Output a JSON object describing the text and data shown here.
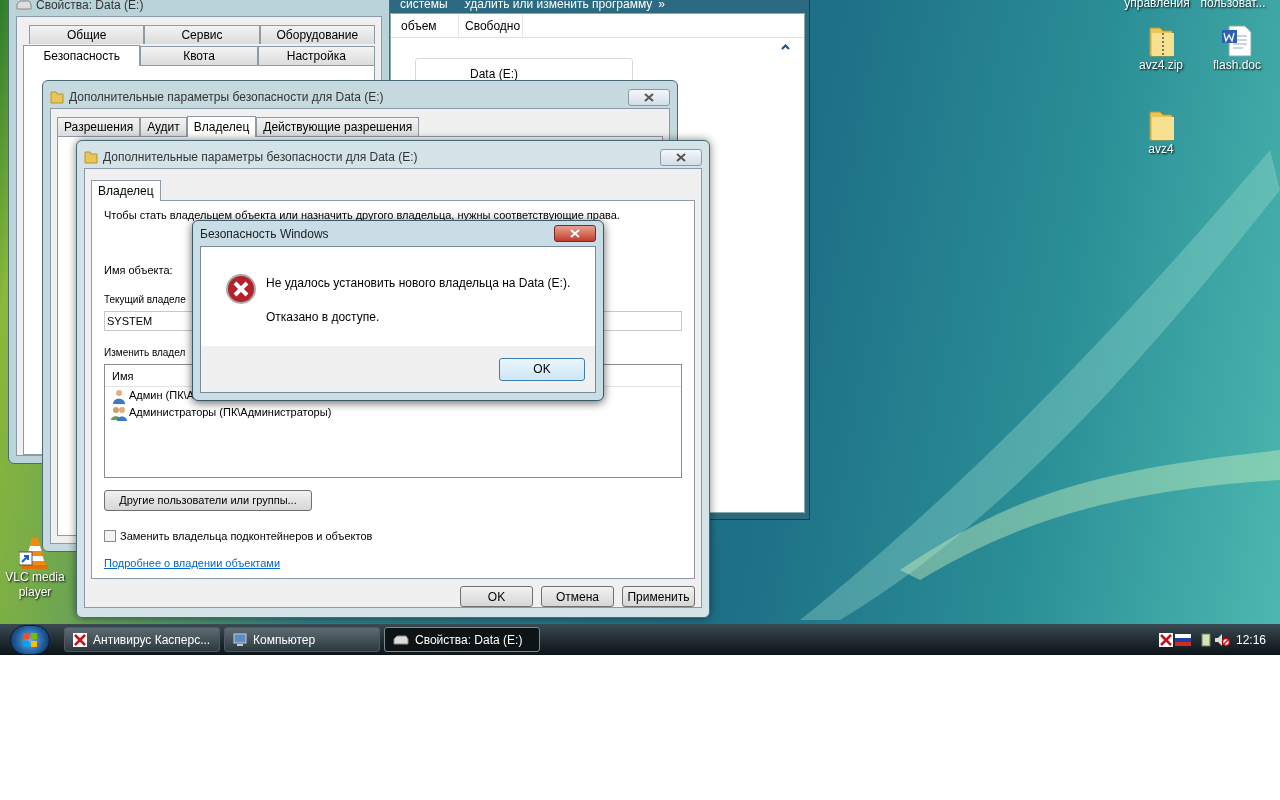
{
  "desktop_icons": [
    {
      "label": "управления",
      "kind": "cut"
    },
    {
      "label": "пользоват...",
      "kind": "cut"
    },
    {
      "label": "avz4.zip",
      "kind": "zip"
    },
    {
      "label": "flash.doc",
      "kind": "doc"
    },
    {
      "label": "avz4",
      "kind": "folder"
    },
    {
      "label": "VLC media player",
      "kind": "vlc"
    }
  ],
  "explorer": {
    "toolbar": [
      "системы",
      "Удалить или изменить программу",
      "»"
    ],
    "columns": [
      "объем",
      "Свободно"
    ],
    "drive": "Data (E:)"
  },
  "properties": {
    "title": "Свойства: Data (E:)",
    "tab_rows": [
      [
        {
          "label": "Общие",
          "selected": false
        },
        {
          "label": "Сервис",
          "selected": false
        },
        {
          "label": "Оборудование",
          "selected": false
        }
      ],
      [
        {
          "label": "Безопасность",
          "selected": true
        },
        {
          "label": "Квота",
          "selected": false
        },
        {
          "label": "Настройка",
          "selected": false
        }
      ]
    ]
  },
  "advanced": {
    "title": "Дополнительные параметры безопасности для Data (E:)",
    "tabs": [
      {
        "label": "Разрешения",
        "selected": false
      },
      {
        "label": "Аудит",
        "selected": false
      },
      {
        "label": "Владелец",
        "selected": true
      },
      {
        "label": "Действующие разрешения",
        "selected": false
      }
    ]
  },
  "owner_dialog": {
    "title": "Дополнительные параметры безопасности для Data (E:)",
    "tabs": [
      {
        "label": "Владелец",
        "selected": true
      }
    ],
    "intro": "Чтобы стать владельцем объекта или назначить другого владельца, нужны соответствующие права.",
    "object_label": "Имя объекта:",
    "current_owner_label": "Текущий владеле",
    "current_owner_value": "SYSTEM",
    "change_label": "Изменить владел",
    "list_header": "Имя",
    "users": [
      {
        "name": "Админ (ПК\\А",
        "kind": "user"
      },
      {
        "name": "Администраторы (ПК\\Администраторы)",
        "kind": "group"
      }
    ],
    "other_button": "Другие пользователи или группы...",
    "replace_checkbox": {
      "label": "Заменить владельца подконтейнеров и объектов",
      "checked": false
    },
    "link": "Подробнее о владении объектами",
    "buttons": [
      "OK",
      "Отмена",
      "Применить"
    ]
  },
  "error_dialog": {
    "title": "Безопасность Windows",
    "message": "Не удалось установить нового владельца на Data (E:).",
    "detail": "Отказано в доступе.",
    "button": "OK"
  },
  "taskbar": {
    "items": [
      {
        "label": "Антивирус Касперс...",
        "kind": "kaspersky",
        "selected": false
      },
      {
        "label": "Компьютер",
        "kind": "computer",
        "selected": false
      },
      {
        "label": "Свойства: Data (E:)",
        "kind": "drive",
        "selected": true
      }
    ],
    "clock": "12:16"
  }
}
